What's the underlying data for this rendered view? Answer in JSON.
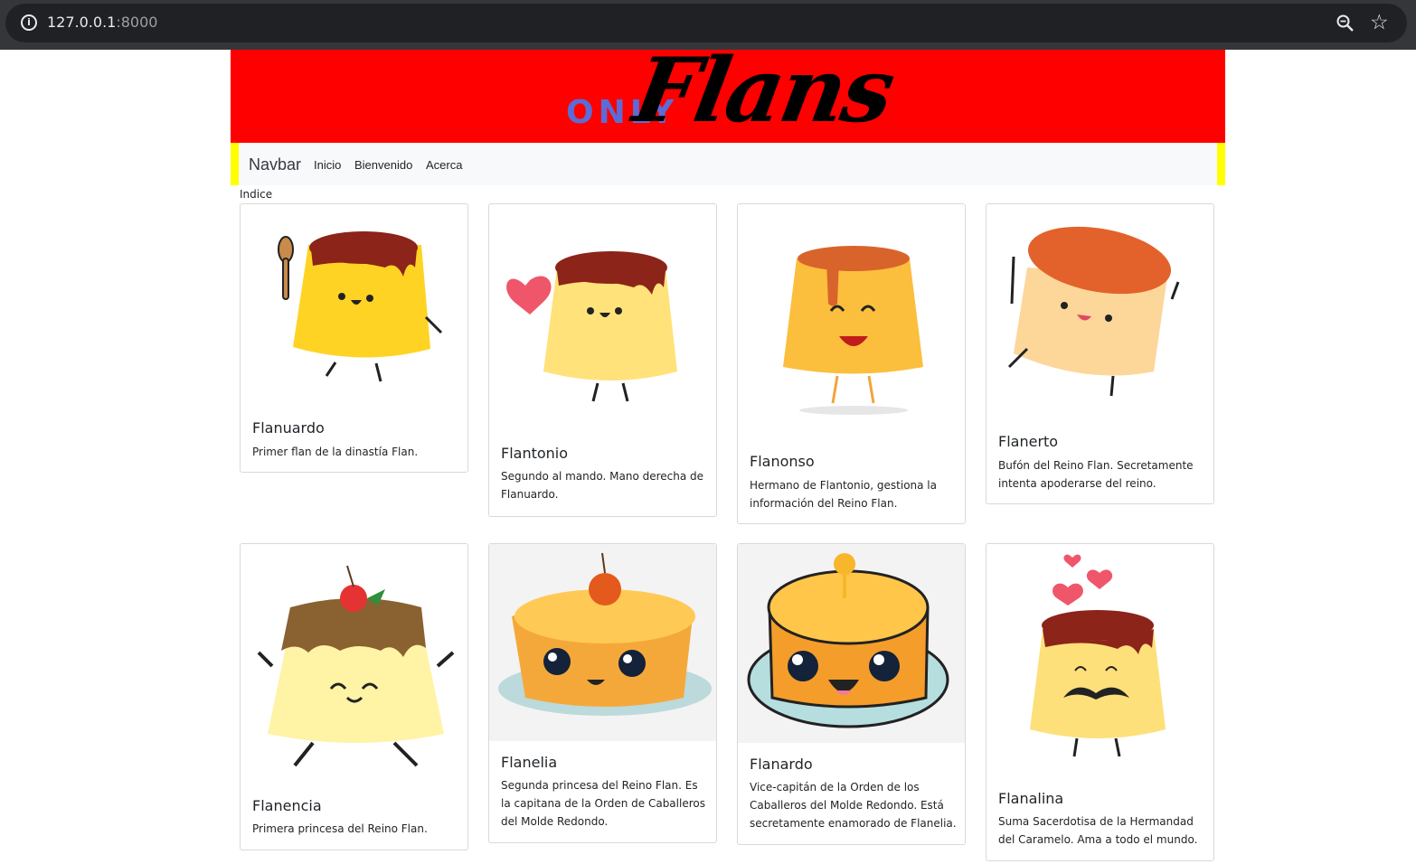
{
  "browser": {
    "url_host": "127.0.0.1",
    "url_port": ":8000",
    "info_icon": "i"
  },
  "banner": {
    "logo_only": "ONLY",
    "logo_flans": "Flans",
    "background": "#ff0000"
  },
  "navbar": {
    "brand": "Navbar",
    "links": [
      "Inicio",
      "Bienvenido",
      "Acerca"
    ],
    "accent": "#ffff00"
  },
  "section_label": "Indice",
  "cards": [
    {
      "title": "Flanuardo",
      "text": "Primer flan de la dinastía Flan.",
      "icon": "flan-with-spoon"
    },
    {
      "title": "Flantonio",
      "text": "Segundo al mando. Mano derecha de Flanuardo.",
      "icon": "flan-with-heart"
    },
    {
      "title": "Flanonso",
      "text": "Hermano de Flantonio, gestiona la información del Reino Flan.",
      "icon": "flan-smiling"
    },
    {
      "title": "Flanerto",
      "text": "Bufón del Reino Flan. Secretamente intenta apoderarse del reino.",
      "icon": "flan-jumping"
    },
    {
      "title": "Flanencia",
      "text": "Primera princesa del Reino Flan.",
      "icon": "flan-with-cherry"
    },
    {
      "title": "Flanelia",
      "text": "Segunda princesa del Reino Flan. Es la capitana de la Orden de Caballeros del Molde Redondo.",
      "icon": "flan-cake-with-cherry"
    },
    {
      "title": "Flanardo",
      "text": "Vice-capitán de la Orden de los Caballeros del Molde Redondo. Está secretamente enamorado de Flanelia.",
      "icon": "flan-cake-on-plate"
    },
    {
      "title": "Flanalina",
      "text": "Suma Sacerdotisa de la Hermandad del Caramelo. Ama a todo el mundo.",
      "icon": "flan-with-hearts-mustache"
    }
  ]
}
